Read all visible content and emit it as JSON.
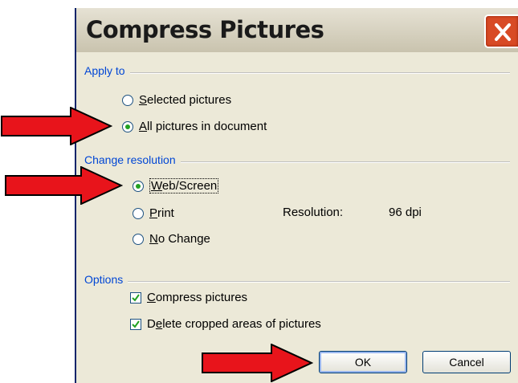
{
  "dialog": {
    "title": "Compress Pictures",
    "close_icon": "close-icon"
  },
  "apply_to": {
    "label": "Apply to",
    "options": [
      {
        "text_underlined": "S",
        "text_rest": "elected pictures",
        "selected": false
      },
      {
        "text_underlined": "A",
        "text_rest": "ll pictures in document",
        "selected": true
      }
    ]
  },
  "change_resolution": {
    "label": "Change resolution",
    "options": [
      {
        "text_underlined": "W",
        "text_rest": "eb/Screen",
        "selected": true
      },
      {
        "text_underlined": "P",
        "text_rest": "rint",
        "selected": false
      },
      {
        "text_underlined": "N",
        "text_rest": "o Change",
        "selected": false
      }
    ],
    "resolution_label": "Resolution:",
    "resolution_value": "96 dpi"
  },
  "options": {
    "label": "Options",
    "checks": [
      {
        "text_underlined": "C",
        "text_rest": "ompress pictures",
        "checked": true
      },
      {
        "text_before": "D",
        "text_underlined": "e",
        "text_rest": "lete cropped areas of pictures",
        "checked": true
      }
    ]
  },
  "buttons": {
    "ok": "OK",
    "cancel": "Cancel"
  },
  "colors": {
    "arrow_fill": "#e8141b",
    "group_label": "#0046d5",
    "dialog_bg": "#ece9d8"
  }
}
